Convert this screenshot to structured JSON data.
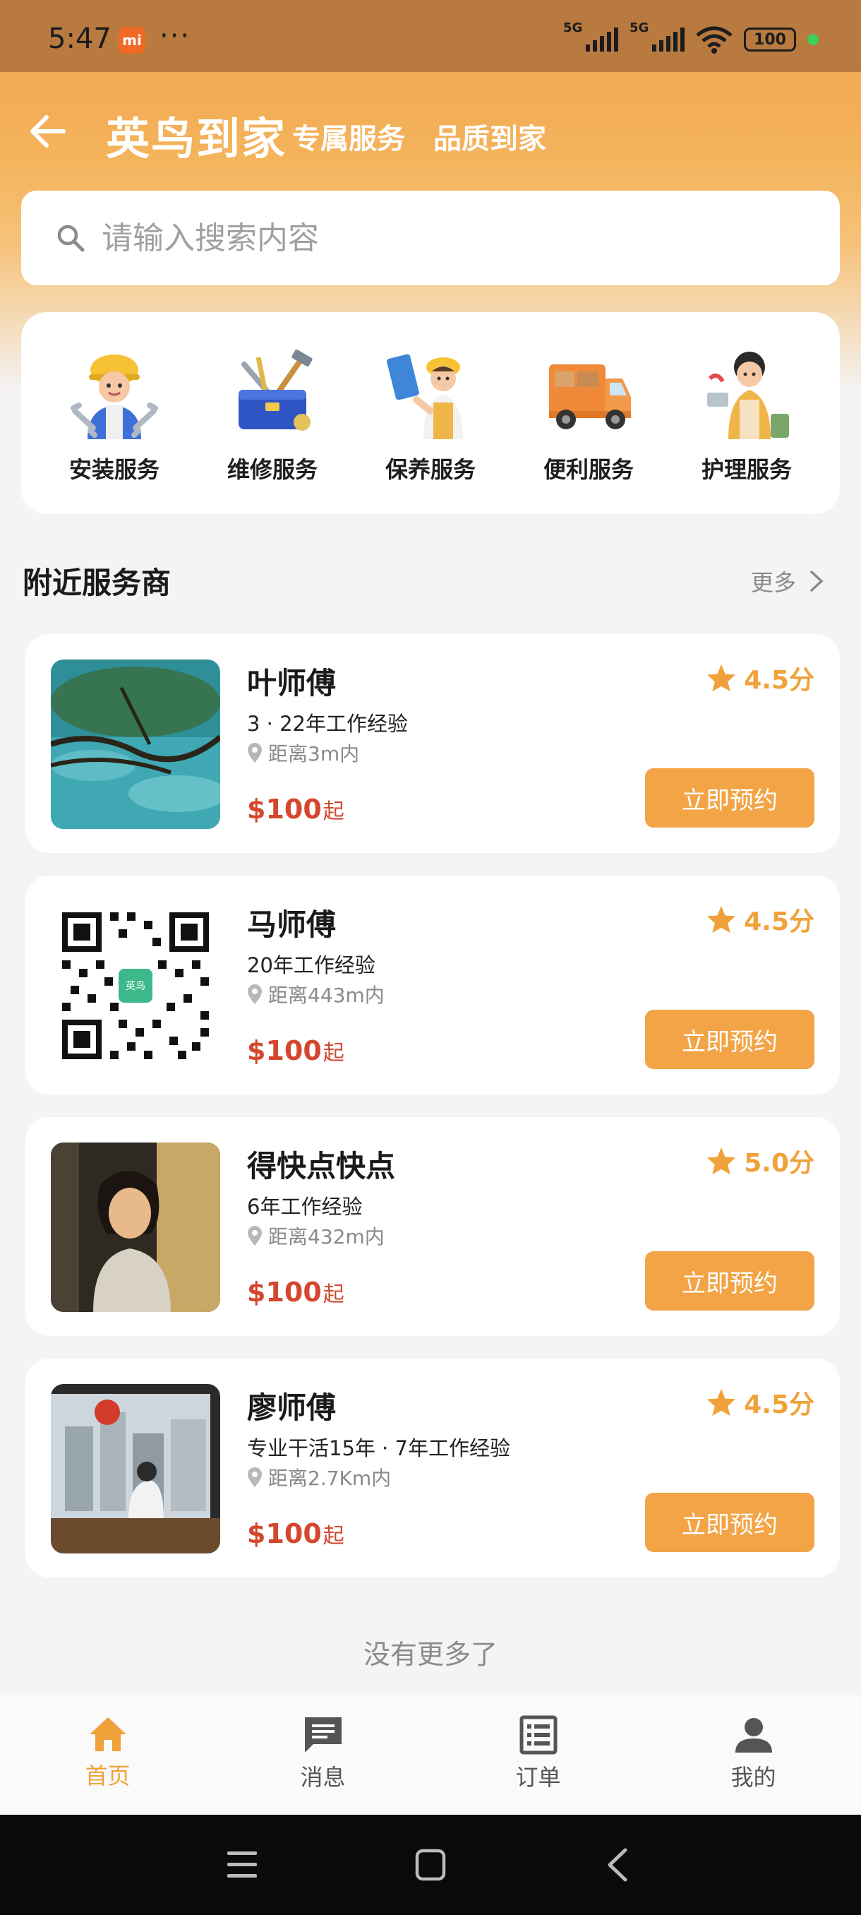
{
  "status_bar": {
    "time": "5:47",
    "mi_badge": "mi",
    "dots": "···",
    "network1": "5G",
    "network2": "5G",
    "battery": "100"
  },
  "header": {
    "brand": "英鸟到家",
    "slogan1": "专属服务",
    "slogan2": "品质到家"
  },
  "search": {
    "placeholder": "请输入搜索内容"
  },
  "categories": [
    {
      "label": "安装服务",
      "icon": "installer-worker-icon"
    },
    {
      "label": "维修服务",
      "icon": "toolbox-icon"
    },
    {
      "label": "保养服务",
      "icon": "cleaning-worker-icon"
    },
    {
      "label": "便利服务",
      "icon": "delivery-truck-icon"
    },
    {
      "label": "护理服务",
      "icon": "caregiver-icon"
    }
  ],
  "section": {
    "title": "附近服务商",
    "more": "更多"
  },
  "providers": [
    {
      "name": "叶师傅",
      "experience": "3 · 22年工作经验",
      "distance": "距离3m内",
      "price": "$100",
      "price_suffix": "起",
      "rating": "4.5分",
      "button": "立即预约",
      "image": "lake-tree-photo"
    },
    {
      "name": "马师傅",
      "experience": "20年工作经验",
      "distance": "距离443m内",
      "price": "$100",
      "price_suffix": "起",
      "rating": "4.5分",
      "button": "立即预约",
      "image": "qr-code",
      "qr_badge": "英鸟"
    },
    {
      "name": "得快点快点",
      "experience": "6年工作经验",
      "distance": "距离432m内",
      "price": "$100",
      "price_suffix": "起",
      "rating": "5.0分",
      "button": "立即预约",
      "image": "portrait-photo"
    },
    {
      "name": "廖师傅",
      "experience": "专业干活15年 · 7年工作经验",
      "distance": "距离2.7Km内",
      "price": "$100",
      "price_suffix": "起",
      "rating": "4.5分",
      "button": "立即预约",
      "image": "city-window-photo"
    }
  ],
  "footer_note": "没有更多了",
  "tabs": [
    {
      "label": "首页",
      "icon": "home-icon",
      "active": true
    },
    {
      "label": "消息",
      "icon": "message-icon",
      "active": false
    },
    {
      "label": "订单",
      "icon": "order-list-icon",
      "active": false
    },
    {
      "label": "我的",
      "icon": "user-icon",
      "active": false
    }
  ],
  "colors": {
    "accent": "#f2a446",
    "price": "#d4472e",
    "rating": "#f0a23a"
  }
}
